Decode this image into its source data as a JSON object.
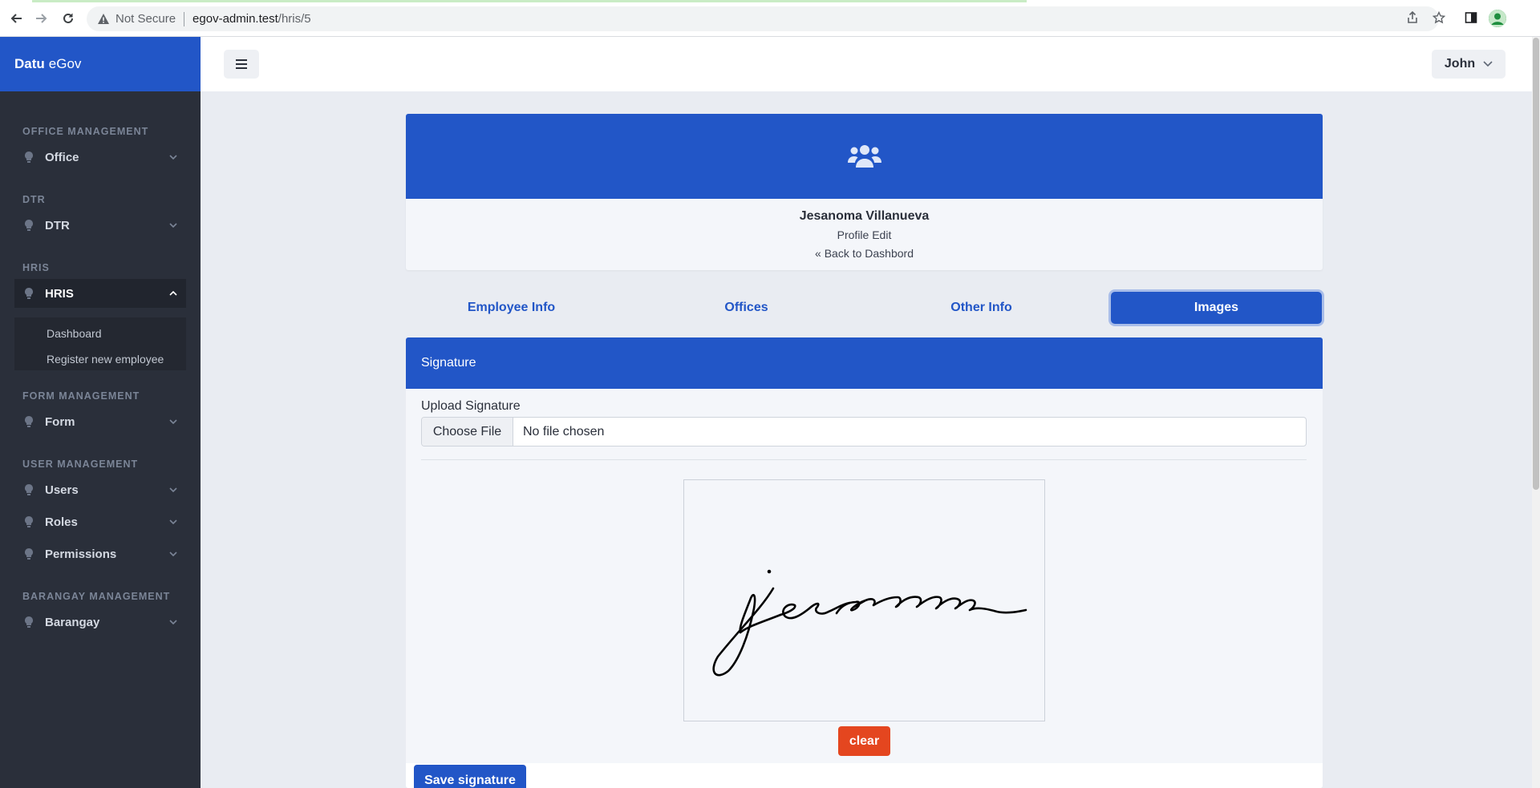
{
  "browser": {
    "security_label": "Not Secure",
    "url_host": "egov-admin.test",
    "url_path": "/hris/5"
  },
  "sidebar": {
    "brand_prefix": "Datu",
    "brand_suffix": "eGov",
    "sections": [
      {
        "label": "OFFICE MANAGEMENT",
        "items": [
          {
            "label": "Office",
            "icon": "lightbulb-icon"
          }
        ]
      },
      {
        "label": "DTR",
        "items": [
          {
            "label": "DTR",
            "icon": "lightbulb-icon"
          }
        ]
      },
      {
        "label": "HRIS",
        "items": [
          {
            "label": "HRIS",
            "icon": "lightbulb-icon",
            "expanded": true,
            "children": [
              "Dashboard",
              "Register new employee"
            ]
          }
        ]
      },
      {
        "label": "FORM MANAGEMENT",
        "items": [
          {
            "label": "Form",
            "icon": "lightbulb-icon"
          }
        ]
      },
      {
        "label": "USER MANAGEMENT",
        "items": [
          {
            "label": "Users",
            "icon": "lightbulb-icon"
          },
          {
            "label": "Roles",
            "icon": "lightbulb-icon"
          },
          {
            "label": "Permissions",
            "icon": "lightbulb-icon"
          }
        ]
      },
      {
        "label": "BARANGAY MANAGEMENT",
        "items": [
          {
            "label": "Barangay",
            "icon": "lightbulb-icon"
          }
        ]
      }
    ]
  },
  "topbar": {
    "user_name": "John"
  },
  "profile": {
    "name": "Jesanoma Villanueva",
    "subtitle": "Profile Edit",
    "back_link": "« Back to Dashbord"
  },
  "tabs": [
    {
      "label": "Employee Info",
      "active": false
    },
    {
      "label": "Offices",
      "active": false
    },
    {
      "label": "Other Info",
      "active": false
    },
    {
      "label": "Images",
      "active": true
    }
  ],
  "signature": {
    "header": "Signature",
    "upload_label": "Upload Signature",
    "choose_file_label": "Choose File",
    "file_status": "No file chosen",
    "clear_label": "clear",
    "save_label": "Save signature"
  },
  "colors": {
    "primary": "#2256c7",
    "sidebar_bg": "#2a2f3a",
    "danger": "#e4461f",
    "page_bg": "#e9ecf2"
  }
}
